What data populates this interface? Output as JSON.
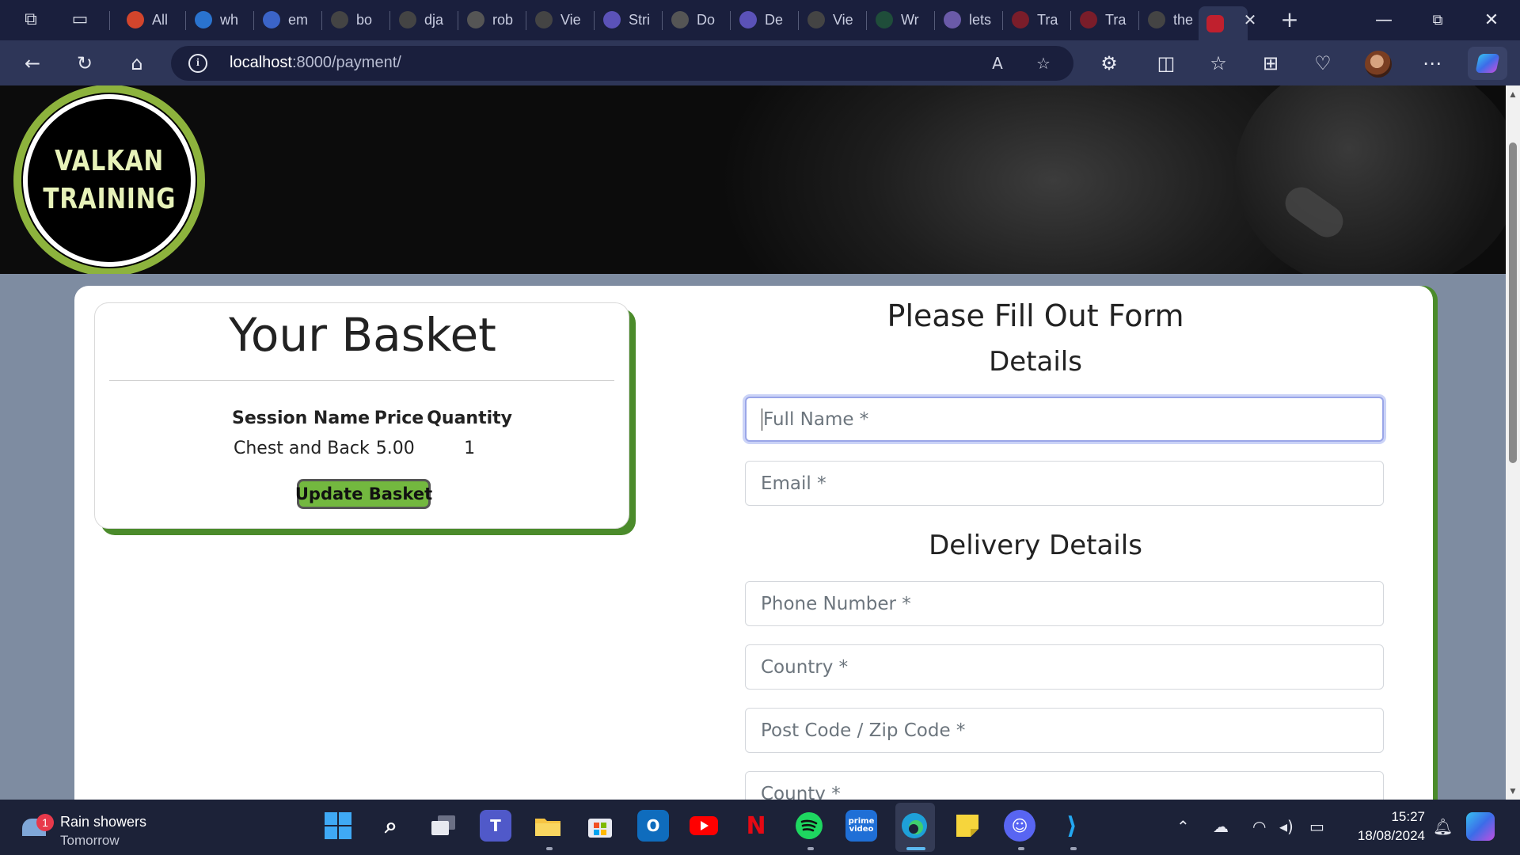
{
  "browser": {
    "tabs": [
      {
        "label": "All",
        "icon": "opera-icon",
        "color": "#d2452c"
      },
      {
        "label": "wh",
        "icon": "bing-icon",
        "color": "#2a73cf"
      },
      {
        "label": "em",
        "icon": "search-icon",
        "color": "#3b64c8"
      },
      {
        "label": "bo",
        "icon": "github-icon",
        "color": "#444"
      },
      {
        "label": "dja",
        "icon": "github-icon",
        "color": "#444"
      },
      {
        "label": "rob",
        "icon": "google-icon",
        "color": "#555"
      },
      {
        "label": "Vie",
        "icon": "github-icon",
        "color": "#444"
      },
      {
        "label": "Stri",
        "icon": "stripe-icon",
        "color": "#5b52b8"
      },
      {
        "label": "Do",
        "icon": "google-docs-icon",
        "color": "#555"
      },
      {
        "label": "De",
        "icon": "stripe-icon",
        "color": "#5b52b8"
      },
      {
        "label": "Vie",
        "icon": "github-icon",
        "color": "#444"
      },
      {
        "label": "Wr",
        "icon": "django-icon",
        "color": "#1f4d3a"
      },
      {
        "label": "lets",
        "icon": "k-icon",
        "color": "#6a5aa8"
      },
      {
        "label": "Tra",
        "icon": "site-icon",
        "color": "#7a1d2a"
      },
      {
        "label": "Tra",
        "icon": "site-icon",
        "color": "#7a1d2a"
      },
      {
        "label": "the",
        "icon": "github-icon",
        "color": "#444"
      }
    ],
    "url_host": "localhost",
    "url_path": ":8000/payment/"
  },
  "logo": {
    "line1": "VALKAN",
    "line2": "TRAINING"
  },
  "basket": {
    "title": "Your Basket",
    "headers": {
      "session": "Session Name",
      "price": "Price",
      "quantity": "Quantity"
    },
    "items": [
      {
        "session": "Chest and Back",
        "price": "5.00",
        "quantity": "1"
      }
    ],
    "update_button": "Update Basket"
  },
  "form": {
    "title": "Please Fill Out Form",
    "details_heading": "Details",
    "delivery_heading": "Delivery Details",
    "placeholders": {
      "full_name": "Full Name *",
      "email": "Email *",
      "phone": "Phone Number *",
      "country": "Country *",
      "postcode": "Post Code / Zip Code *",
      "county": "County *"
    }
  },
  "taskbar": {
    "weather_badge": "1",
    "weather_title": "Rain showers",
    "weather_sub": "Tomorrow",
    "time": "15:27",
    "date": "18/08/2024"
  },
  "colors": {
    "accent_green": "#4b8b2b",
    "button_green": "#73b83f"
  }
}
